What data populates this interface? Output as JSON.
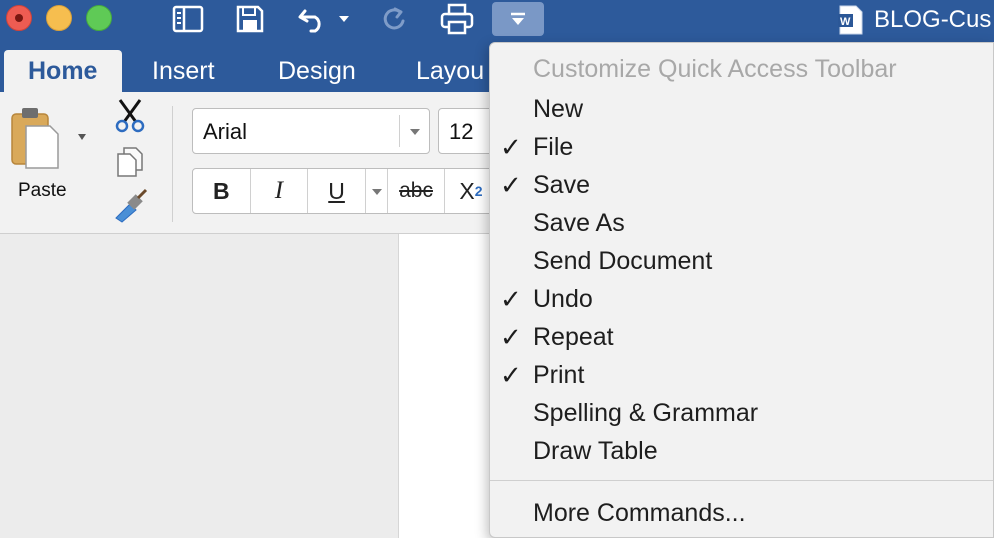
{
  "window": {
    "document_title": "BLOG-Cus"
  },
  "quick_access_toolbar": {
    "icons": [
      "sidebar-icon",
      "save-icon",
      "undo-icon",
      "repeat-icon",
      "print-icon",
      "customize-dropdown-icon"
    ]
  },
  "ribbon_tabs": [
    {
      "label": "Home",
      "active": true
    },
    {
      "label": "Insert",
      "active": false
    },
    {
      "label": "Design",
      "active": false
    },
    {
      "label": "Layou",
      "active": false
    }
  ],
  "ribbon": {
    "paste_label": "Paste",
    "font_name": "Arial",
    "font_size": "12",
    "format_buttons": {
      "bold": "B",
      "italic": "I",
      "underline": "U",
      "strikethrough": "abc",
      "subscript_base": "X",
      "subscript_sub": "2"
    }
  },
  "customize_menu": {
    "header": "Customize Quick Access Toolbar",
    "items": [
      {
        "label": "New",
        "checked": false
      },
      {
        "label": "File",
        "checked": true
      },
      {
        "label": "Save",
        "checked": true
      },
      {
        "label": "Save As",
        "checked": false
      },
      {
        "label": "Send Document",
        "checked": false
      },
      {
        "label": "Undo",
        "checked": true
      },
      {
        "label": "Repeat",
        "checked": true
      },
      {
        "label": "Print",
        "checked": true
      },
      {
        "label": "Spelling & Grammar",
        "checked": false
      },
      {
        "label": "Draw Table",
        "checked": false
      }
    ],
    "footer_item": "More Commands...",
    "check_glyph": "✓"
  },
  "colors": {
    "title_blue": "#2d5a9b",
    "ribbon_bg": "#f2f2f2",
    "menu_header_gray": "#a8a8a8"
  }
}
